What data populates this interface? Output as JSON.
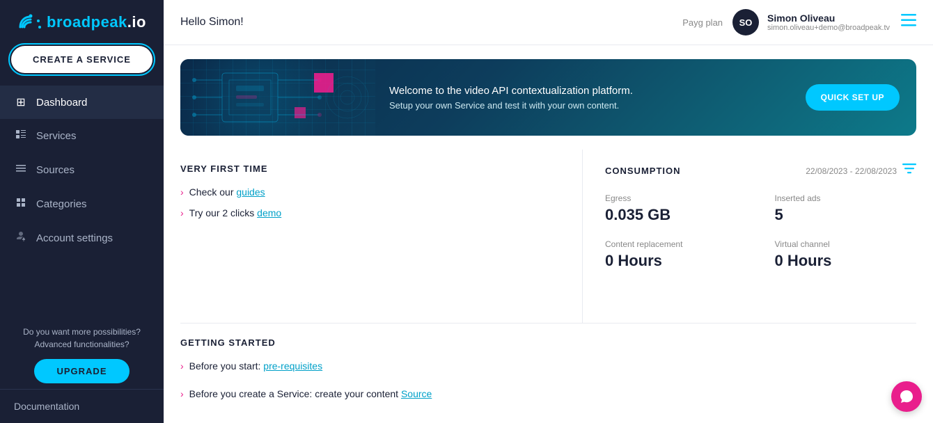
{
  "sidebar": {
    "logo": "broadpeak",
    "logo_suffix": ".io",
    "create_service_label": "CREATE A SERVICE",
    "nav_items": [
      {
        "id": "dashboard",
        "label": "Dashboard",
        "icon": "⊞",
        "active": true
      },
      {
        "id": "services",
        "label": "Services",
        "icon": "🗂",
        "active": false
      },
      {
        "id": "sources",
        "label": "Sources",
        "icon": "≡",
        "active": false
      },
      {
        "id": "categories",
        "label": "Categories",
        "icon": "🏷",
        "active": false
      },
      {
        "id": "account-settings",
        "label": "Account settings",
        "icon": "⚙",
        "active": false
      }
    ],
    "upgrade_prompt": "Do you want more possibilities?\nAdvanced functionalities?",
    "upgrade_label": "UPGRADE",
    "documentation_label": "Documentation"
  },
  "header": {
    "greeting": "Hello Simon!",
    "plan": "Payg plan",
    "avatar_initials": "SO",
    "username": "Simon Oliveau",
    "email": "simon.oliveau+demo@broadpeak.tv"
  },
  "banner": {
    "title": "Welcome to the video API contextualization platform.",
    "subtitle": "Setup your own Service and test it with your own content.",
    "quick_setup_label": "QUICK SET UP"
  },
  "very_first_time": {
    "section_title": "VERY FIRST TIME",
    "items": [
      {
        "text": "Check our ",
        "link_text": "guides",
        "link": "#"
      },
      {
        "text": "Try our 2 clicks ",
        "link_text": "demo",
        "link": "#"
      }
    ]
  },
  "consumption": {
    "section_title": "CONSUMPTION",
    "date_range": "22/08/2023 - 22/08/2023",
    "metrics": [
      {
        "label": "Egress",
        "value": "0.035 GB"
      },
      {
        "label": "Inserted ads",
        "value": "5"
      },
      {
        "label": "Content replacement",
        "value": "0 Hours"
      },
      {
        "label": "Virtual channel",
        "value": "0 Hours"
      }
    ]
  },
  "getting_started": {
    "section_title": "GETTING STARTED",
    "items": [
      {
        "text": "Before you start: ",
        "link_text": "pre-requisites",
        "link": "#"
      },
      {
        "text": "Before you create a Service: create your content ",
        "link_text": "Source",
        "link": "#"
      }
    ]
  }
}
